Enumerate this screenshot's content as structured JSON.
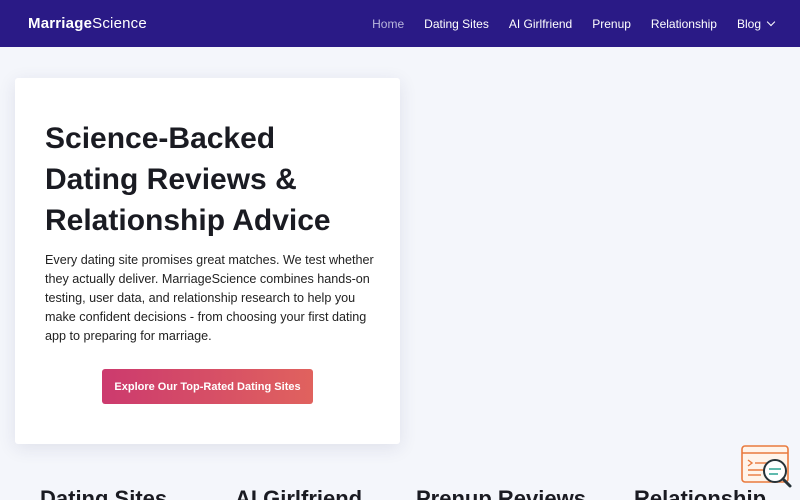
{
  "header": {
    "logo_bold": "Marriage",
    "logo_regular": "Science",
    "nav": [
      {
        "label": "Home",
        "active": true
      },
      {
        "label": "Dating Sites"
      },
      {
        "label": "AI Girlfriend"
      },
      {
        "label": "Prenup"
      },
      {
        "label": "Relationship"
      },
      {
        "label": "Blog",
        "has_dropdown": true
      }
    ]
  },
  "hero": {
    "title": "Science-Backed Dating Reviews & Relationship Advice",
    "description": "Every dating site promises great matches. We test whether they actually deliver. MarriageScience combines hands-on testing, user data, and relationship research to help you make confident decisions - from choosing your first dating app to preparing for marriage.",
    "cta_label": "Explore Our Top-Rated Dating Sites"
  },
  "categories": [
    "Dating Sites",
    "AI Girlfriend",
    "Prenup Reviews",
    "Relationship"
  ],
  "colors": {
    "nav_bg": "#2a1a86",
    "cta_start": "#cc3a6e",
    "cta_end": "#e0625e",
    "widget_accent": "#e97a3d"
  },
  "icons": {
    "chat_widget": "chat-search-icon"
  }
}
